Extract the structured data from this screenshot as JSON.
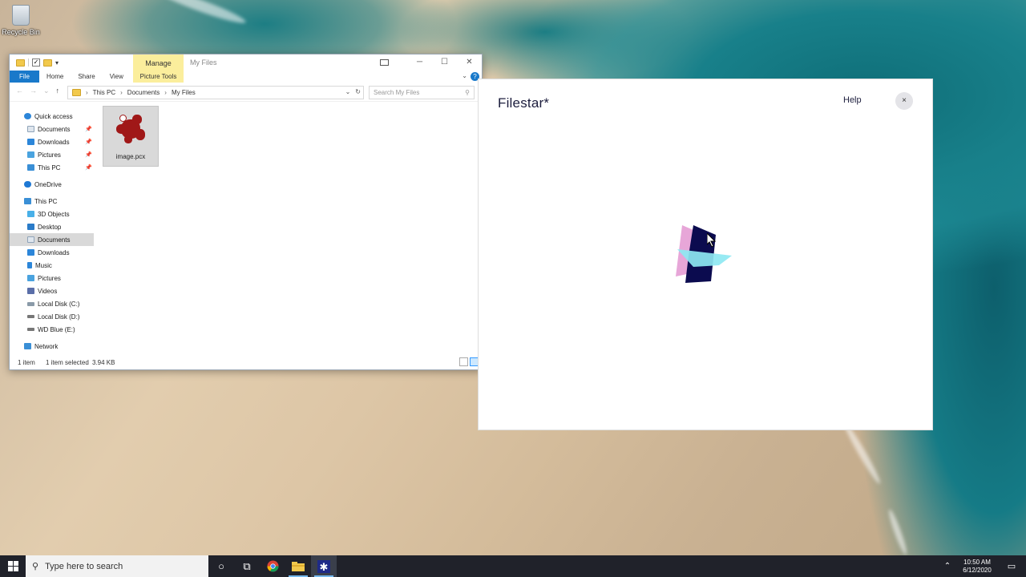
{
  "desktop": {
    "recycle_bin_label": "Recycle Bin"
  },
  "explorer": {
    "window_title": "My Files",
    "manage_tab": "Manage",
    "ribbon_tabs": [
      "File",
      "Home",
      "Share",
      "View"
    ],
    "picture_tools_tab": "Picture Tools",
    "breadcrumb": [
      "This PC",
      "Documents",
      "My Files"
    ],
    "search_placeholder": "Search My Files",
    "nav": {
      "quick_access": "Quick access",
      "qa_documents": "Documents",
      "qa_downloads": "Downloads",
      "qa_pictures": "Pictures",
      "qa_thispc": "This PC",
      "onedrive": "OneDrive",
      "thispc": "This PC",
      "objects3d": "3D Objects",
      "desktop": "Desktop",
      "documents": "Documents",
      "downloads": "Downloads",
      "music": "Music",
      "pictures": "Pictures",
      "videos": "Videos",
      "local_c": "Local Disk (C:)",
      "local_d": "Local Disk (D:)",
      "wd_blue": "WD Blue (E:)",
      "network": "Network"
    },
    "files": [
      {
        "name": "image.pcx"
      }
    ],
    "status": {
      "count": "1 item",
      "selected": "1 item selected",
      "size": "3.94 KB"
    }
  },
  "filestar": {
    "title": "Filestar*",
    "help_label": "Help",
    "close_label": "×",
    "colors": {
      "navy": "#0b0b4f",
      "pink": "#e7a6d8",
      "cyan": "#8ee8f2"
    }
  },
  "taskbar": {
    "search_placeholder": "Type here to search",
    "time": "10:50 AM",
    "date": "6/12/2020",
    "icons": [
      "windows-icon",
      "cortana-icon",
      "task-view-icon",
      "chrome-icon",
      "file-explorer-icon",
      "filestar-icon"
    ]
  }
}
